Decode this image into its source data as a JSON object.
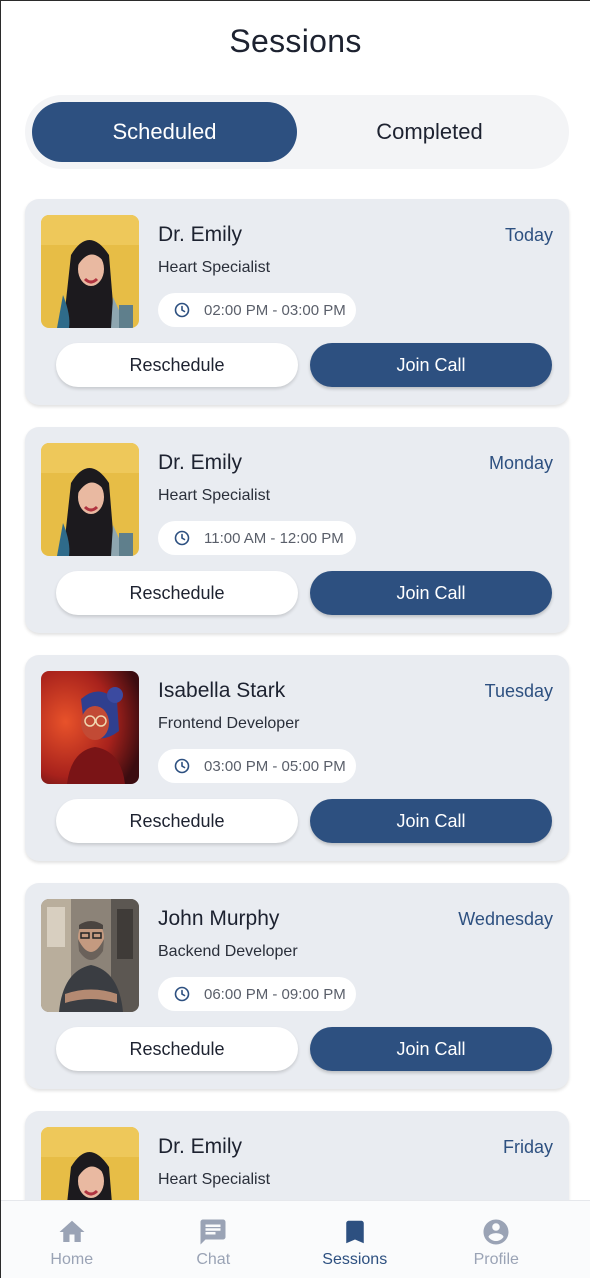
{
  "header": {
    "title": "Sessions"
  },
  "tabs": {
    "scheduled": "Scheduled",
    "completed": "Completed",
    "active": "Scheduled"
  },
  "sessions": [
    {
      "name": "Dr. Emily",
      "role": "Heart Specialist",
      "day": "Today",
      "time": "02:00 PM - 03:00 PM",
      "avatar": "woman-yellow-wall",
      "reschedule": "Reschedule",
      "join": "Join Call"
    },
    {
      "name": "Dr. Emily",
      "role": "Heart Specialist",
      "day": "Monday",
      "time": "11:00 AM - 12:00 PM",
      "avatar": "woman-yellow-wall",
      "reschedule": "Reschedule",
      "join": "Join Call"
    },
    {
      "name": "Isabella Stark",
      "role": "Frontend Developer",
      "day": "Tuesday",
      "time": "03:00 PM - 05:00 PM",
      "avatar": "woman-red-light",
      "reschedule": "Reschedule",
      "join": "Join Call"
    },
    {
      "name": "John Murphy",
      "role": "Backend Developer",
      "day": "Wednesday",
      "time": "06:00 PM - 09:00 PM",
      "avatar": "bearded-man-office",
      "reschedule": "Reschedule",
      "join": "Join Call"
    },
    {
      "name": "Dr. Emily",
      "role": "Heart Specialist",
      "day": "Friday",
      "avatar": "woman-yellow-wall"
    }
  ],
  "bottom_nav": [
    {
      "label": "Home",
      "icon": "home-icon"
    },
    {
      "label": "Chat",
      "icon": "chat-icon"
    },
    {
      "label": "Sessions",
      "icon": "bookmark-icon",
      "active": true
    },
    {
      "label": "Profile",
      "icon": "profile-icon"
    }
  ],
  "colors": {
    "accent": "#2d5080",
    "card": "#e9ecf1",
    "nav_inactive": "#9aa3b5"
  }
}
